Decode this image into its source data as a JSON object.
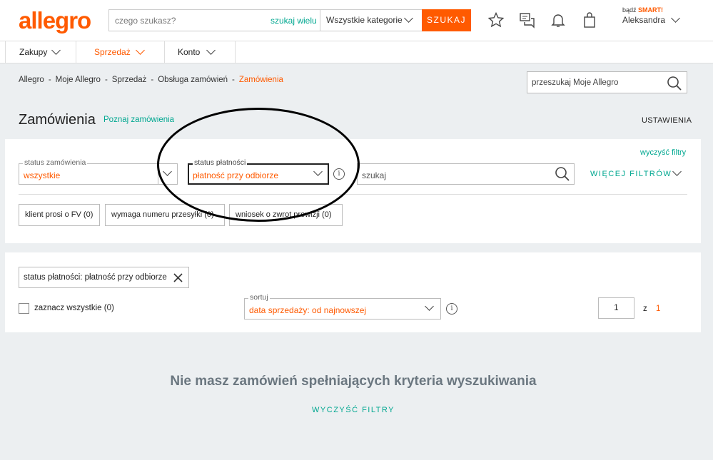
{
  "header": {
    "logo": "allegro",
    "search_placeholder": "czego szukasz?",
    "search_many": "szukaj wielu",
    "category": "Wszystkie kategorie",
    "search_button": "SZUKAJ",
    "smart_prefix": "bądź",
    "smart_label": "SMART!",
    "username": "Aleksandra"
  },
  "nav": {
    "tabs": [
      {
        "label": "Zakupy"
      },
      {
        "label": "Sprzedaż"
      },
      {
        "label": "Konto"
      }
    ]
  },
  "breadcrumb": {
    "items": [
      "Allegro",
      "Moje Allegro",
      "Sprzedaż",
      "Obsługa zamówień"
    ],
    "current": "Zamówienia",
    "separator": "-"
  },
  "my_search_placeholder": "przeszukaj Moje Allegro",
  "page": {
    "title": "Zamówienia",
    "learn_link": "Poznaj zamówienia",
    "settings": "USTAWIENIA"
  },
  "filters": {
    "clear_filters": "wyczyść filtry",
    "order_status": {
      "legend": "status zamówienia",
      "value": "wszystkie"
    },
    "payment_status": {
      "legend": "status płatności",
      "value": "płatność przy odbiorze"
    },
    "search_placeholder": "szukaj",
    "more_filters": "WIĘCEJ FILTRÓW",
    "chips": [
      {
        "label": "klient prosi o FV (0)"
      },
      {
        "label": "wymaga numeru przesyłki (0)"
      },
      {
        "label": "wniosek o zwrot prowizji (0)"
      }
    ]
  },
  "results": {
    "active_filter": "status płatności: płatność przy odbiorze",
    "select_all": "zaznacz wszystkie (0)",
    "sort": {
      "legend": "sortuj",
      "value": "data sprzedaży: od najnowszej"
    },
    "page_current": "1",
    "page_of": "z",
    "page_total": "1",
    "empty_message": "Nie masz zamówień spełniających kryteria wyszukiwania",
    "clear_filters_button": "WYCZYŚĆ FILTRY"
  },
  "colors": {
    "brand": "#ff5a00",
    "accent": "#00a790"
  }
}
